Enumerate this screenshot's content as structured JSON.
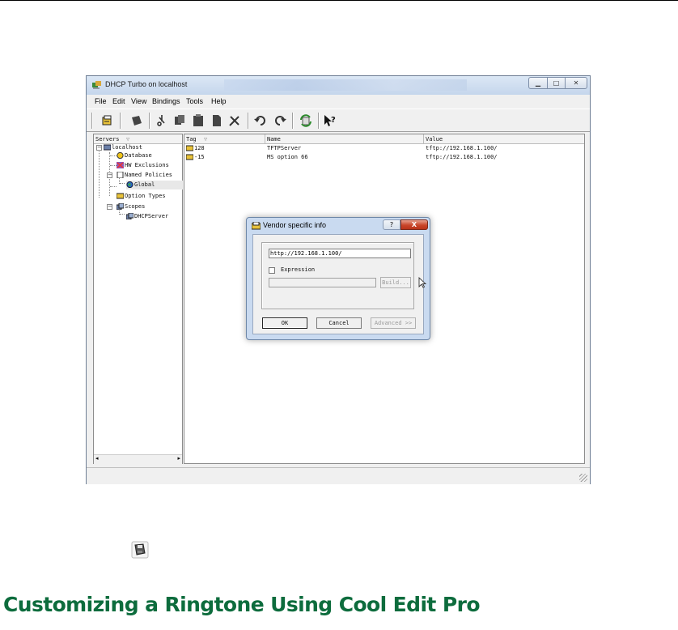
{
  "window": {
    "title": "DHCP Turbo on localhost",
    "menu": [
      "File",
      "Edit",
      "View",
      "Bindings",
      "Tools",
      "Help"
    ]
  },
  "toolbar_icons": [
    "new-option-icon",
    "cube-icon",
    "scissors-icon",
    "copy-icon",
    "paste-icon",
    "page-icon",
    "tools-icon",
    "undo-icon",
    "redo-icon",
    "refresh-icon",
    "whats-this-icon"
  ],
  "tree": {
    "header": "Servers",
    "items": [
      {
        "label": "localhost",
        "icon": "server-icon"
      },
      {
        "label": "Database",
        "icon": "database-icon"
      },
      {
        "label": "HW Exclusions",
        "icon": "hw-exclusions-icon"
      },
      {
        "label": "Named Policies",
        "icon": "policies-icon"
      },
      {
        "label": "Global",
        "icon": "globe-icon"
      },
      {
        "label": "Option Types",
        "icon": "option-types-icon"
      },
      {
        "label": "Scopes",
        "icon": "scopes-icon"
      },
      {
        "label": "DHCPServer",
        "icon": "scope-icon"
      }
    ]
  },
  "list": {
    "columns": [
      "Tag",
      "Name",
      "Value"
    ],
    "rows": [
      {
        "tag": "128",
        "name": "TFTPServer",
        "value": "tftp://192.168.1.100/"
      },
      {
        "tag": "-15",
        "name": "MS option 66",
        "value": "tftp://192.168.1.100/"
      }
    ]
  },
  "dialog": {
    "title": "Vendor specific info",
    "help": "?",
    "close": "X",
    "url_value": "http://192.168.1.100/",
    "expression_label": "Expression",
    "build_label": "Build...",
    "ok_label": "OK",
    "cancel_label": "Cancel",
    "advanced_label": "Advanced >>"
  },
  "doc": {
    "heading": "Customizing a Ringtone Using Cool Edit Pro"
  },
  "colors": {
    "heading": "#0d6c3d"
  }
}
